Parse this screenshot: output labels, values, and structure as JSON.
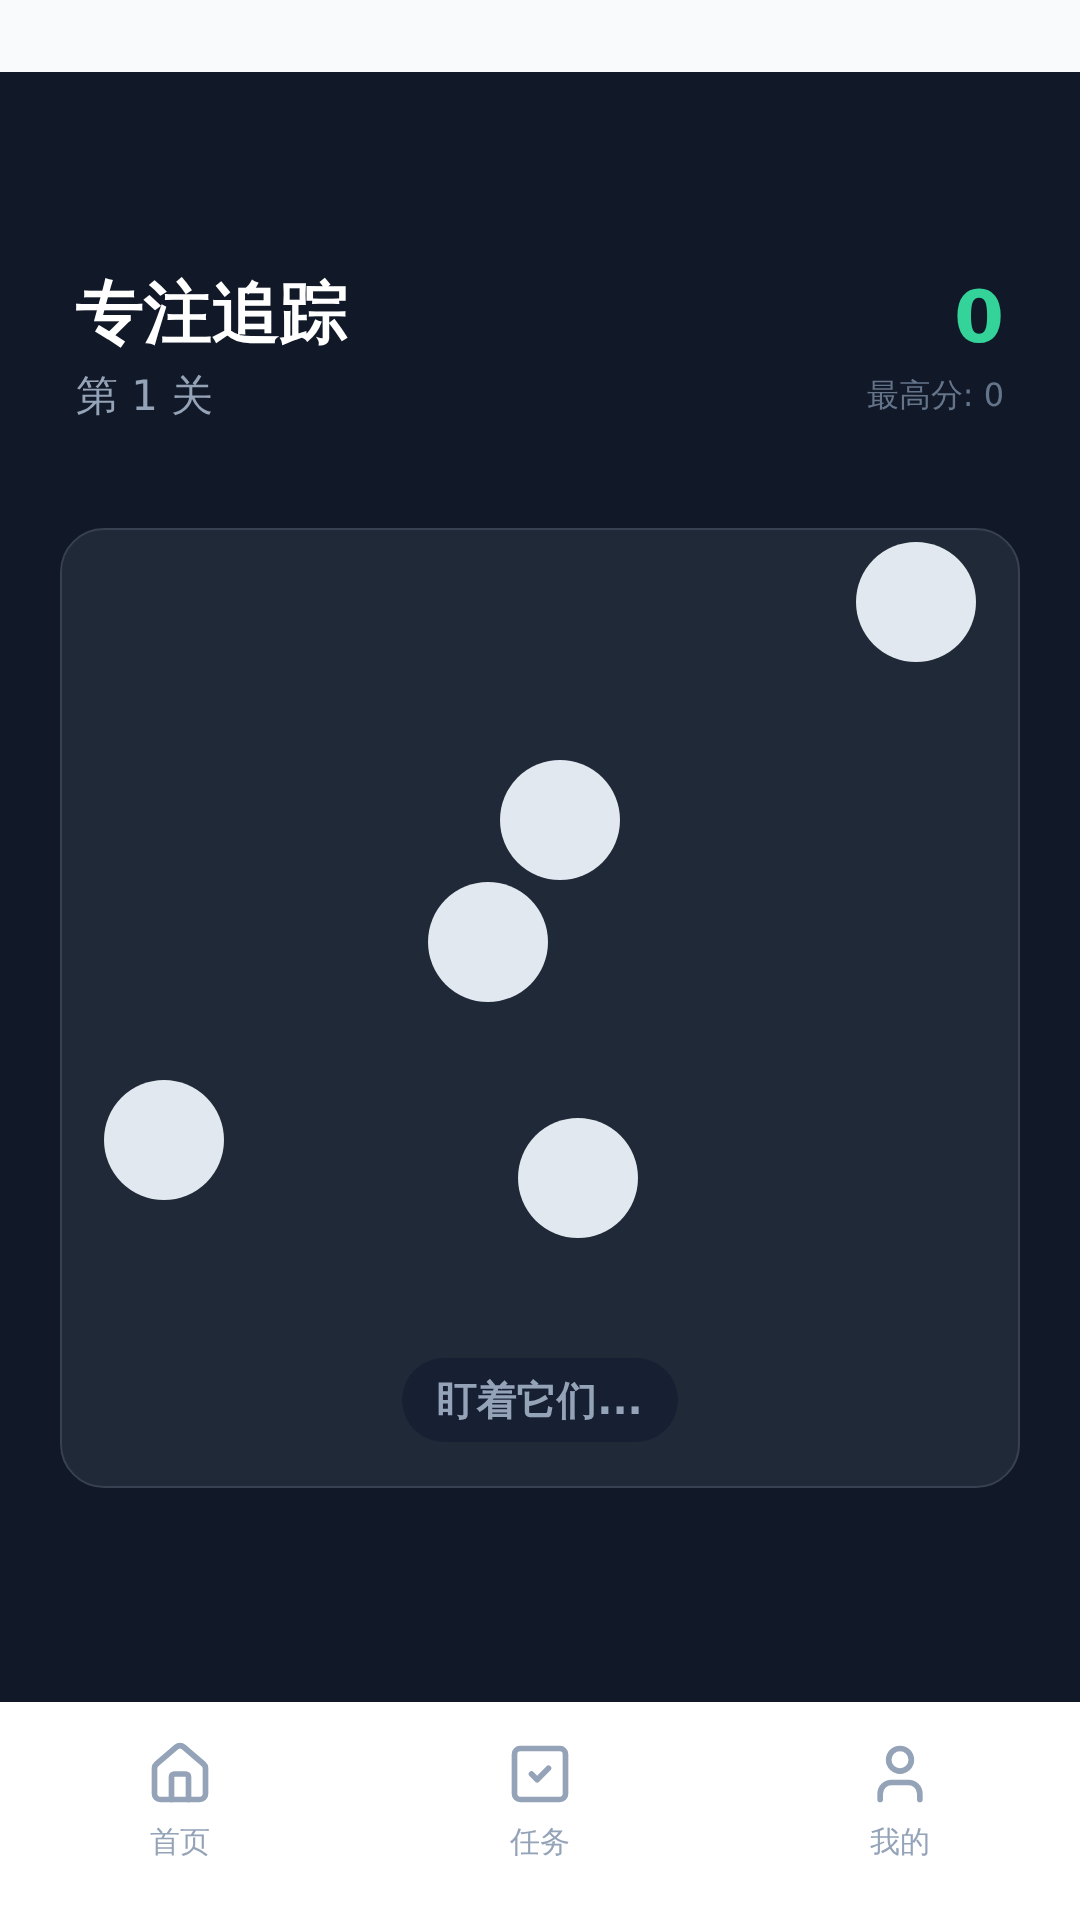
{
  "header": {
    "title": "专注追踪",
    "level": "第 1 关",
    "score": "0",
    "best": "最高分: 0"
  },
  "arena": {
    "balls": [
      {
        "kind": "ball"
      },
      {
        "kind": "ball"
      },
      {
        "kind": "ball"
      },
      {
        "kind": "ball"
      },
      {
        "kind": "ball"
      }
    ],
    "hint": "盯着它们..."
  },
  "nav": [
    {
      "label": "首页",
      "kind": "home"
    },
    {
      "label": "任务",
      "kind": "tasks"
    },
    {
      "label": "我的",
      "kind": "profile"
    }
  ]
}
